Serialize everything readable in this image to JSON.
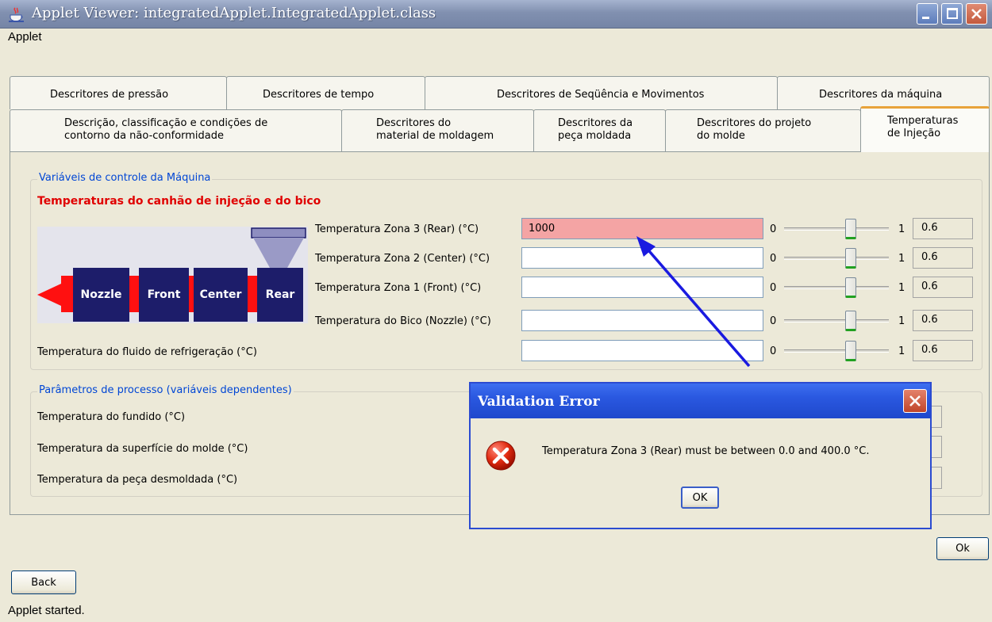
{
  "window": {
    "title": "Applet Viewer: integratedApplet.IntegratedApplet.class",
    "menu": [
      "Applet"
    ]
  },
  "tabs": {
    "row1": [
      "Descritores de pressão",
      "Descritores de tempo",
      "Descritores de Seqüência e Movimentos",
      "Descritores da máquina"
    ],
    "row2": [
      [
        "Descrição, classificação e condições de",
        "contorno da não-conformidade"
      ],
      [
        "Descritores do",
        "material de moldagem"
      ],
      [
        "Descritores da",
        "peça moldada"
      ],
      [
        "Descritores do projeto",
        "do molde"
      ],
      [
        "Temperaturas",
        "de Injeção"
      ]
    ],
    "active": "Temperaturas de Injeção"
  },
  "machine_group": {
    "title": "Variáveis de controle da Máquina",
    "heading": "Temperaturas do canhão de injeção e do bico",
    "diagram_labels": [
      "Nozzle",
      "Front",
      "Center",
      "Rear"
    ],
    "rows": [
      {
        "label": "Temperatura Zona 3 (Rear) (°C)",
        "value": "1000",
        "min": "0",
        "max": "1",
        "slider_value": "0.6",
        "error": true
      },
      {
        "label": "Temperatura Zona 2 (Center) (°C)",
        "value": "",
        "min": "0",
        "max": "1",
        "slider_value": "0.6",
        "error": false
      },
      {
        "label": "Temperatura Zona 1 (Front) (°C)",
        "value": "",
        "min": "0",
        "max": "1",
        "slider_value": "0.6",
        "error": false
      },
      {
        "label": "Temperatura do Bico (Nozzle) (°C)",
        "value": "",
        "min": "0",
        "max": "1",
        "slider_value": "0.6",
        "error": false
      },
      {
        "label": "Temperatura do fluido de refrigeração (°C)",
        "value": "",
        "min": "0",
        "max": "1",
        "slider_value": "0.6",
        "error": false
      }
    ]
  },
  "process_group": {
    "title": "Parâmetros de processo (variáveis dependentes)",
    "rows": [
      "Temperatura do fundido (°C)",
      "Temperatura da superfície do molde (°C)",
      "Temperatura da peça desmoldada (°C)"
    ]
  },
  "buttons": {
    "ok": "Ok",
    "back": "Back"
  },
  "status": "Applet started.",
  "dialog": {
    "title": "Validation Error",
    "message": "Temperatura Zona 3 (Rear) must be between 0.0 and 400.0 °C.",
    "ok": "OK",
    "icon": "error-icon"
  },
  "colors": {
    "error_field": "#f4a4a4",
    "heading_red": "#e00000",
    "group_title": "#0046d5",
    "active_tab": "#e8a33a",
    "annotation_arrow": "#1a1ae0"
  }
}
